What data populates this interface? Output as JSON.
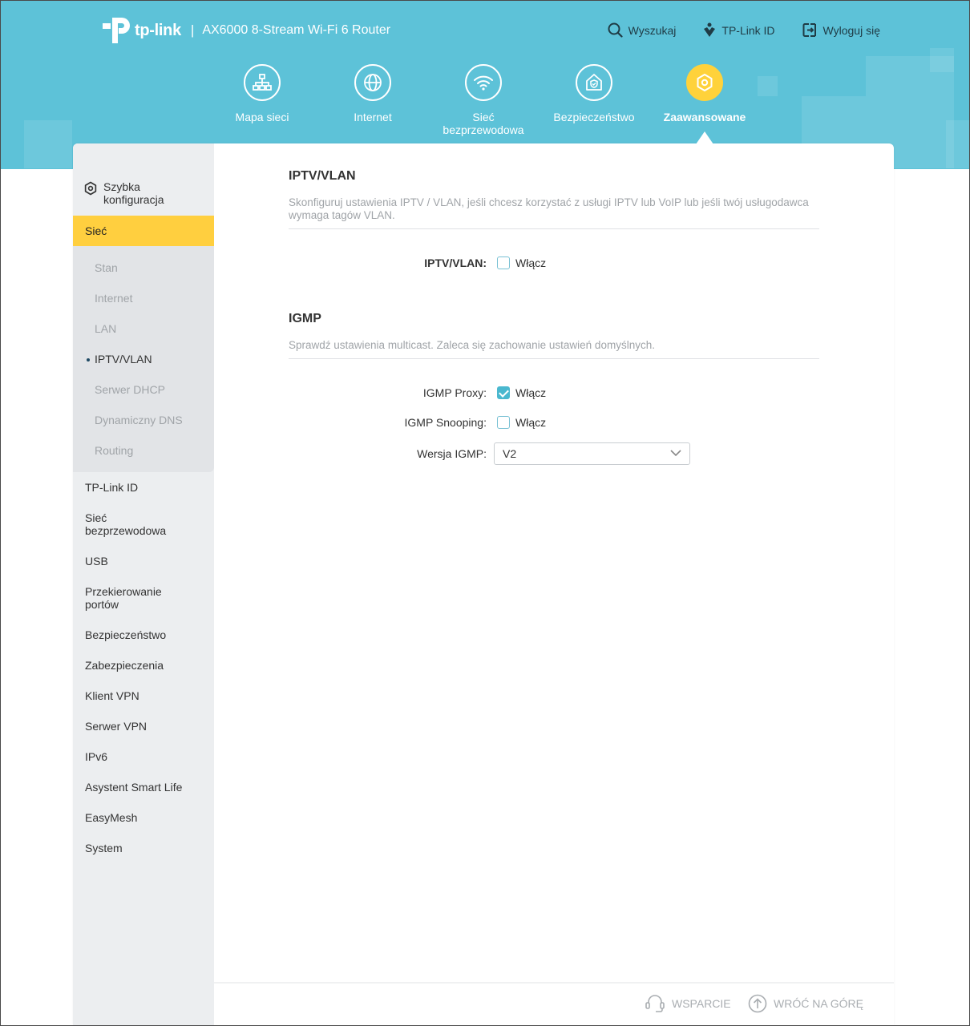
{
  "header": {
    "brand": "tp-link",
    "separator": "|",
    "model": "AX6000 8-Stream Wi-Fi 6 Router",
    "links": {
      "search": "Wyszukaj",
      "tplink_id": "TP-Link ID",
      "logout": "Wyloguj się"
    }
  },
  "nav": [
    {
      "label": "Mapa sieci",
      "icon": "network-map-icon"
    },
    {
      "label": "Internet",
      "icon": "globe-icon"
    },
    {
      "label": "Sieć bezprzewodowa",
      "icon": "wifi-icon"
    },
    {
      "label": "Bezpieczeństwo",
      "icon": "home-shield-icon"
    },
    {
      "label": "Zaawansowane",
      "icon": "gear-icon",
      "active": true
    }
  ],
  "sidebar": {
    "quick_setup": "Szybka konfiguracja",
    "network": "Sieć",
    "network_sub": [
      "Stan",
      "Internet",
      "LAN",
      "IPTV/VLAN",
      "Serwer DHCP",
      "Dynamiczny DNS",
      "Routing"
    ],
    "active_sub": "IPTV/VLAN",
    "items": [
      "TP-Link ID",
      "Sieć bezprzewodowa",
      "USB",
      "Przekierowanie portów",
      "Bezpieczeństwo",
      "Zabezpieczenia",
      "Klient VPN",
      "Serwer VPN",
      "IPv6",
      "Asystent Smart Life",
      "EasyMesh",
      "System"
    ]
  },
  "iptv": {
    "title": "IPTV/VLAN",
    "desc": "Skonfiguruj ustawienia IPTV / VLAN, jeśli chcesz korzystać z usługi IPTV lub VoIP lub jeśli twój usługodawca wymaga tagów VLAN.",
    "field_label": "IPTV/VLAN:",
    "checkbox_label": "Włącz",
    "checked": false
  },
  "igmp": {
    "title": "IGMP",
    "desc": "Sprawdź ustawienia multicast. Zaleca się zachowanie ustawień domyślnych.",
    "proxy_label": "IGMP Proxy:",
    "proxy_checkbox": "Włącz",
    "proxy_checked": true,
    "snooping_label": "IGMP Snooping:",
    "snooping_checkbox": "Włącz",
    "snooping_checked": false,
    "version_label": "Wersja IGMP:",
    "version_value": "V2"
  },
  "footer": {
    "support": "WSPARCIE",
    "back_to_top": "WRÓĆ NA GÓRĘ"
  },
  "colors": {
    "header_bg": "#5dc2d8",
    "accent_yellow": "#ffcf3f",
    "checkbox_blue": "#4ab8cf"
  }
}
